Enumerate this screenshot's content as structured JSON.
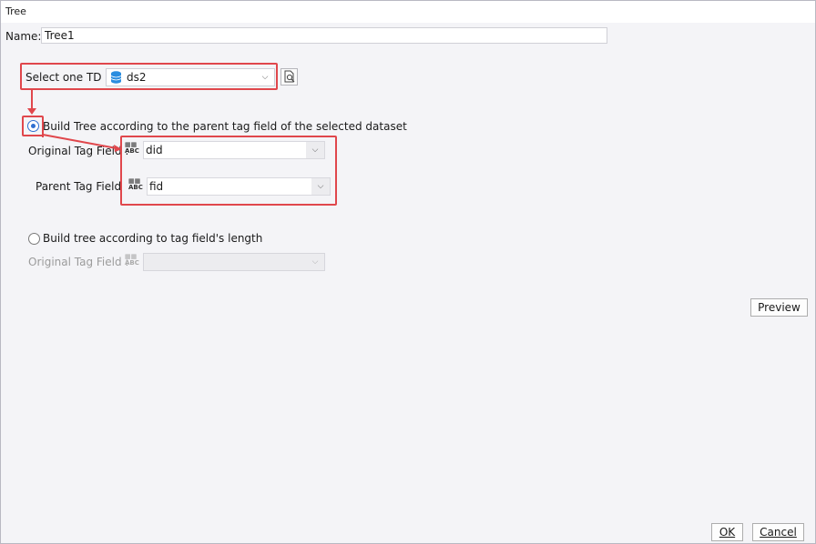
{
  "window": {
    "title": "Tree"
  },
  "name": {
    "label": "Name:",
    "value": "Tree1"
  },
  "dataset": {
    "label": "Select one TD :",
    "value": "ds2"
  },
  "option_parent": {
    "label": "Build Tree according to the parent tag field of the selected dataset",
    "selected": true,
    "original_label": "Original Tag Field :",
    "original_value": "did",
    "parent_label": "Parent Tag Field",
    "parent_value": "fid"
  },
  "option_length": {
    "label": "Build tree according to tag field's length",
    "selected": false,
    "original_label": "Original Tag Field :",
    "original_value": ""
  },
  "buttons": {
    "preview": "Preview",
    "ok": "OK",
    "cancel": "Cancel"
  },
  "colors": {
    "highlight": "#e0474c",
    "radio_accent": "#2f6fd1"
  }
}
